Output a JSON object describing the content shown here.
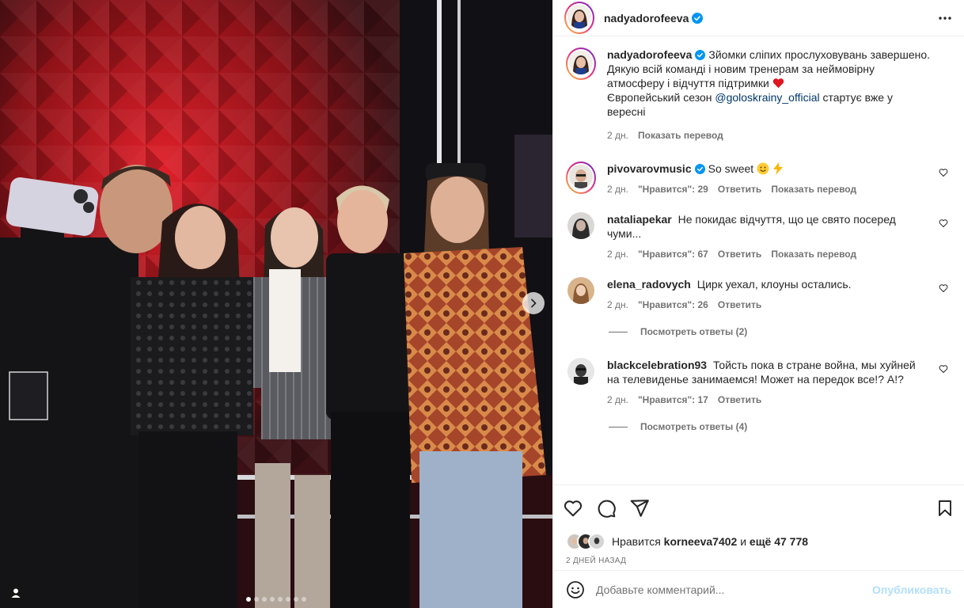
{
  "post": {
    "author": "nadyadorofeeva",
    "author_verified": true,
    "caption_lines": [
      "Зйомки сліпих прослуховувань завершено.",
      "Дякую всій команді і новим тренерам за неймовірну атмосферу і відчуття підтримки",
      "Європейський сезон",
      "@goloskrainy_official",
      "стартує вже у вересні"
    ],
    "caption_time": "2 дн.",
    "caption_translate": "Показать перевод"
  },
  "media": {
    "slide_index": 1,
    "slide_count": 8,
    "next_icon": "chevron-right-icon",
    "tags_icon": "user-tag-icon"
  },
  "comments": [
    {
      "user": "pivovarovmusic",
      "verified": true,
      "text": "So sweet",
      "time": "2 дн.",
      "likes": "\"Нравится\": 29",
      "reply": "Ответить",
      "translate": "Показать перевод",
      "avatar_color": "#d9d4cf"
    },
    {
      "user": "nataliapekar",
      "text": "Не покидає відчуття, що це свято посеред чуми...",
      "time": "2 дн.",
      "likes": "\"Нравится\": 67",
      "reply": "Ответить",
      "translate": "Показать перевод",
      "avatar_color": "#2b2b2b"
    },
    {
      "user": "elena_radovych",
      "text": "Цирк уехал, клоуны остались.",
      "time": "2 дн.",
      "likes": "\"Нравится\": 26",
      "reply": "Ответить",
      "avatar_color": "#c89a6e",
      "view_replies": "Посмотреть ответы (2)"
    },
    {
      "user": "blackcelebration93",
      "text": "Тойсть пока в стране война, мы хуйней на телевиденье занимаемся! Может на передок все!? А!?",
      "time": "2 дн.",
      "likes": "\"Нравится\": 17",
      "reply": "Ответить",
      "avatar_color": "#3a3a3a",
      "view_replies": "Посмотреть ответы (4)"
    }
  ],
  "likes": {
    "prefix": "Нравится",
    "user": "korneeva7402",
    "conj": "и",
    "rest": "ещё 47 778"
  },
  "post_date": "2 ДНЕЙ НАЗАД",
  "add_comment": {
    "placeholder": "Добавьте комментарий...",
    "publish": "Опубликовать"
  },
  "colors": {
    "verified": "#0095f6",
    "heart_red": "#ed4956",
    "link": "#00376b",
    "muted": "#737373",
    "publish_disabled": "#b2dffc"
  }
}
